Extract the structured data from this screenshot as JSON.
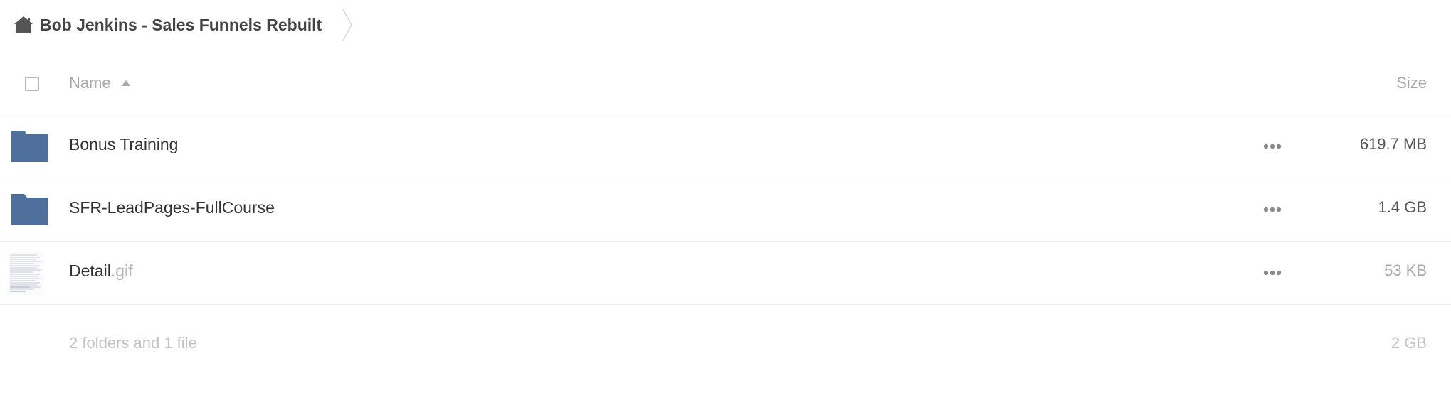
{
  "breadcrumb": {
    "home_icon": "home-icon",
    "current": "Bob Jenkins - Sales Funnels Rebuilt"
  },
  "table": {
    "columns": {
      "name": "Name",
      "size": "Size"
    },
    "sort": "name-ascending",
    "rows": [
      {
        "type": "folder",
        "icon": "folder-icon",
        "name": "Bonus Training",
        "ext": "",
        "size": "619.7 MB",
        "size_color": "#555555"
      },
      {
        "type": "folder",
        "icon": "folder-icon",
        "name": "SFR-LeadPages-FullCourse",
        "ext": "",
        "size": "1.4 GB",
        "size_color": "#555555"
      },
      {
        "type": "file",
        "icon": "file-thumbnail",
        "name": "Detail",
        "ext": ".gif",
        "size": "53 KB",
        "size_color": "#a9a9a9"
      }
    ]
  },
  "summary": {
    "text": "2 folders and 1 file",
    "total_size": "2 GB"
  },
  "colors": {
    "folder": "#4f6f9c",
    "muted_text": "#a9a9a9"
  }
}
